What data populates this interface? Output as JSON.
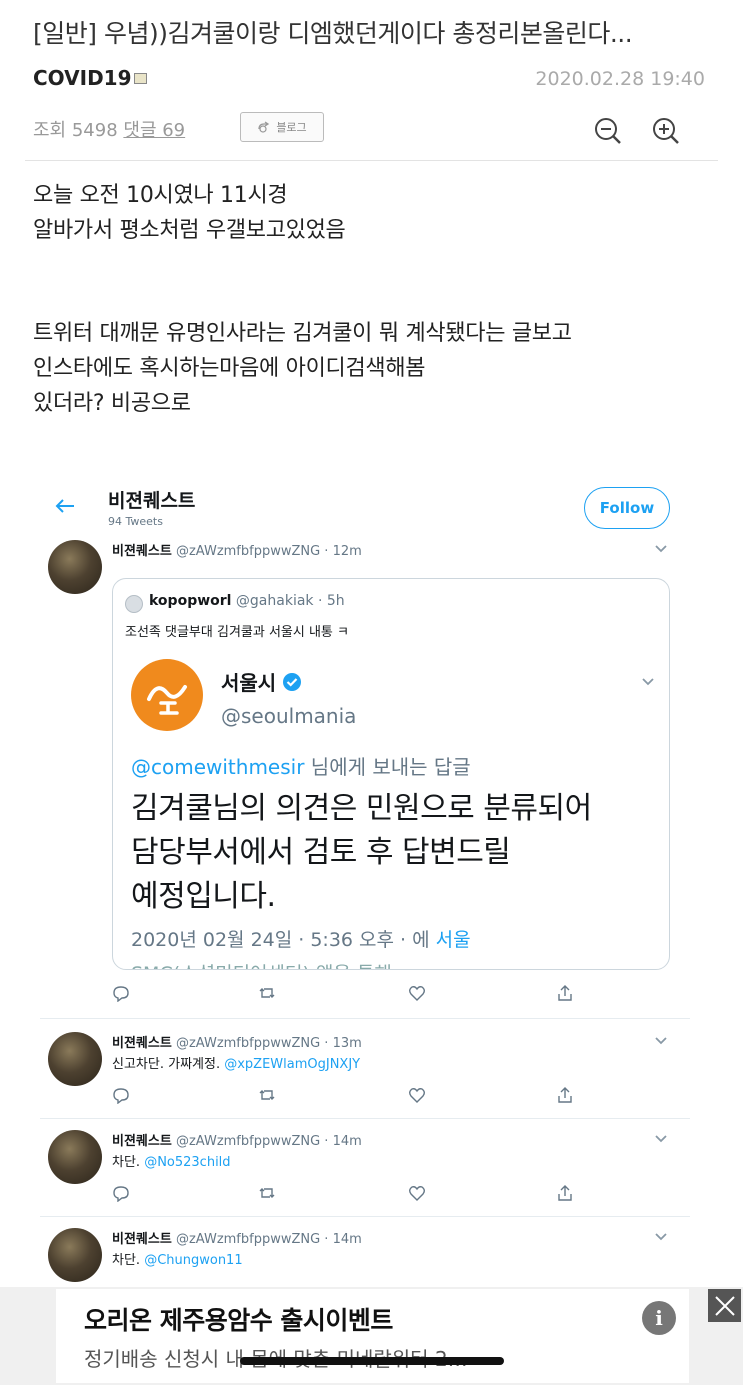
{
  "post": {
    "title": "[일반] 우념))김겨쿨이랑 디엠했던게이다 총정리본올린다...",
    "author": "COVID19",
    "date": "2020.02.28 19:40",
    "views_label": "조회 5498",
    "comments_label": "댓글 69",
    "blog_button": "블로그",
    "paragraph1": [
      "오늘 오전 10시였나 11시경",
      "알바가서 평소처럼 우갤보고있었음"
    ],
    "paragraph2": [
      "트위터 대깨문 유명인사라는 김겨쿨이 뭐 계삭됐다는 글보고",
      "인스타에도 혹시하는마음에 아이디검색해봄",
      "있더라? 비공으로"
    ]
  },
  "twitter": {
    "profile_name": "비젼퀘스트",
    "tweet_count": "94 Tweets",
    "follow_label": "Follow",
    "tweets": [
      {
        "name": "비젼퀘스트",
        "handle_time": "@zAWzmfbfppwwZNG · 12m",
        "quote": {
          "user": "kopopworl",
          "user_meta": "@gahakiak · 5h",
          "text": "조선족 댓글부대 김겨쿨과 서울시 내통 ㅋ",
          "inner_name": "서울시",
          "inner_handle": "@seoulmania",
          "reply_to_handle": "@comewithmesir",
          "reply_to_suffix": " 님에게 보내는 답글",
          "big_lines": [
            "김겨쿨님의 의견은 민원으로 분류되어",
            "담당부서에서 검토 후 답변드릴",
            "예정입니다."
          ],
          "date_text": "2020년 02월 24일 · 5:36 오후 · 에 ",
          "date_link": "서울",
          "cut_text": "SMC(소셜미디어센터) 앱을 통해"
        }
      },
      {
        "name": "비젼퀘스트",
        "handle_time": "@zAWzmfbfppwwZNG · 13m",
        "text": "신고차단. 가짜계정. ",
        "link": "@xpZEWlamOgJNXJY"
      },
      {
        "name": "비젼퀘스트",
        "handle_time": "@zAWzmfbfppwwZNG · 14m",
        "text": "차단. ",
        "link": "@No523child"
      },
      {
        "name": "비젼퀘스트",
        "handle_time": "@zAWzmfbfppwwZNG · 14m",
        "text": "차단. ",
        "link": "@Chungwon11"
      }
    ]
  },
  "ad": {
    "title": "오리온 제주용암수 출시이벤트",
    "subtitle": "정기배송 신청시 내 몸에 맞춘 미네랄워터 2…",
    "info_glyph": "i"
  },
  "icons": [
    "zoom-out-icon",
    "zoom-in-icon",
    "back-arrow-icon",
    "verified-icon",
    "reply-icon",
    "retweet-icon",
    "like-icon",
    "share-icon",
    "chevron-down-icon",
    "close-icon"
  ],
  "colors": {
    "twitter_blue": "#1da1f2",
    "seoul_orange": "#f08a1d",
    "meta_gray": "#999999"
  }
}
